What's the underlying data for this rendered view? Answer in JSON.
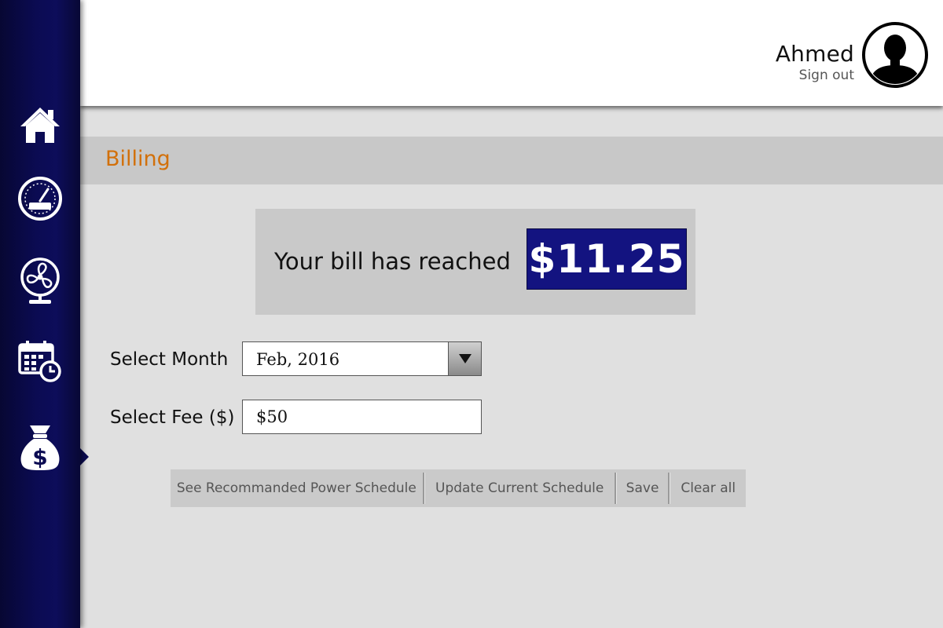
{
  "user": {
    "name": "Ahmed",
    "sign_out": "Sign out"
  },
  "sidebar": {
    "items": [
      {
        "icon": "home-icon",
        "active": false
      },
      {
        "icon": "gauge-icon",
        "active": false
      },
      {
        "icon": "fan-icon",
        "active": false
      },
      {
        "icon": "calendar-clock-icon",
        "active": false
      },
      {
        "icon": "money-bag-icon",
        "active": true
      }
    ]
  },
  "page": {
    "title": "Billing"
  },
  "bill": {
    "label": "Your bill has reached",
    "amount": "$11.25"
  },
  "form": {
    "month_label": "Select Month",
    "month_value": "Feb, 2016",
    "fee_label": "Select Fee ($)",
    "fee_value": "$50"
  },
  "actions": {
    "recommended": "See Recommanded Power Schedule",
    "update": "Update Current Schedule",
    "save": "Save",
    "clear": "Clear all"
  },
  "colors": {
    "sidebar": "#0b0b52",
    "accent_title": "#d2700a",
    "bill_amount_bg": "#131380"
  }
}
